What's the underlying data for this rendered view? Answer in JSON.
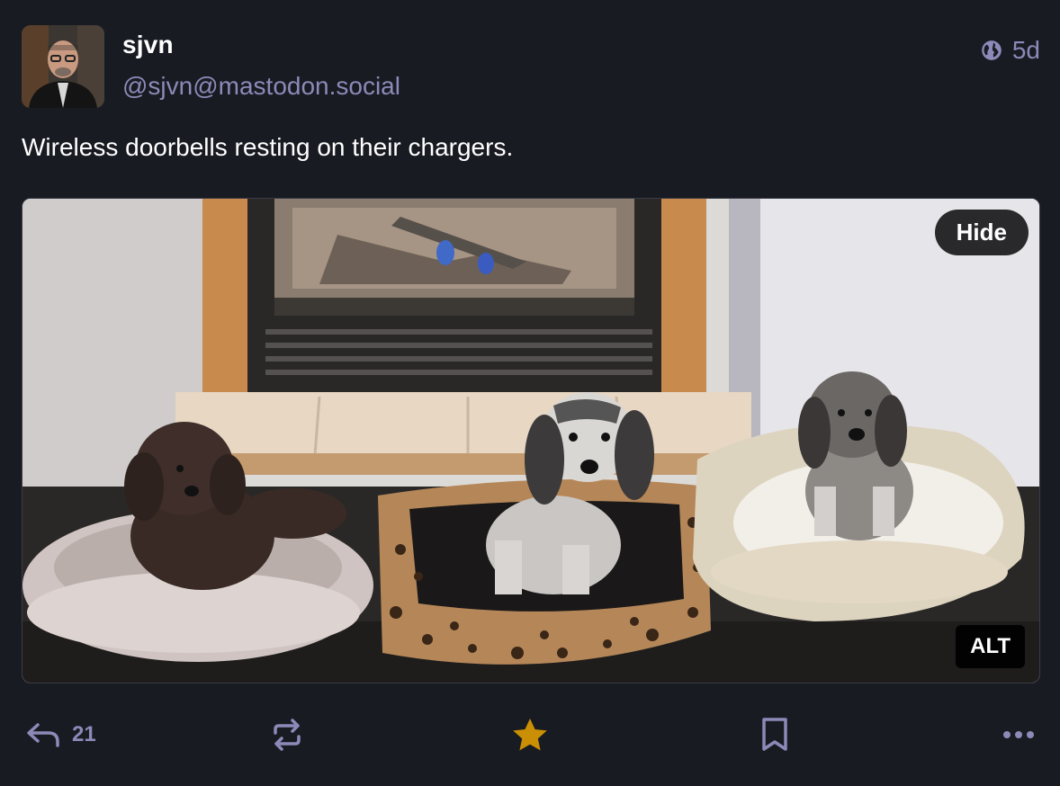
{
  "author": {
    "display_name": "sjvn",
    "handle": "@sjvn@mastodon.social"
  },
  "meta": {
    "visibility_icon": "globe-icon",
    "age": "5d"
  },
  "status": {
    "text": "Wireless doorbells resting on their chargers."
  },
  "media": {
    "hide_label": "Hide",
    "alt_label": "ALT"
  },
  "actions": {
    "reply_icon": "reply-icon",
    "reply_count": "21",
    "boost_icon": "boost-icon",
    "favourite_icon": "star-icon",
    "favourite_active": true,
    "bookmark_icon": "bookmark-icon",
    "more_icon": "more-icon"
  },
  "colors": {
    "background": "#191b22",
    "muted": "#8d89b8",
    "favourite": "#ca8f04"
  }
}
